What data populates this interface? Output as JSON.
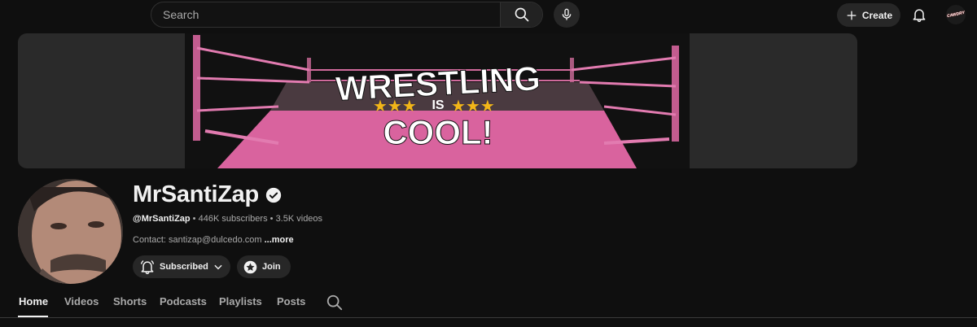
{
  "header": {
    "search_placeholder": "Search",
    "create_label": "Create",
    "account_avatar_text": "CAWDRY"
  },
  "banner": {
    "line1": "WRESTLING",
    "line2": "IS",
    "line3": "COOL!"
  },
  "channel": {
    "name": "MrSantiZap",
    "handle": "@MrSantiZap",
    "subscribers": "446K subscribers",
    "separator": " • ",
    "videos": "3.5K videos",
    "contact": "Contact: santizap@dulcedo.com",
    "more": "...more",
    "subscribed_label": "Subscribed",
    "join_label": "Join"
  },
  "tabs": [
    {
      "label": "Home",
      "active": true
    },
    {
      "label": "Videos"
    },
    {
      "label": "Shorts"
    },
    {
      "label": "Podcasts"
    },
    {
      "label": "Playlists"
    },
    {
      "label": "Posts"
    }
  ],
  "colors": {
    "background": "#0f0f0f",
    "button": "#272727",
    "ring_pink": "#e27bb0",
    "star_gold": "#f2b618"
  }
}
